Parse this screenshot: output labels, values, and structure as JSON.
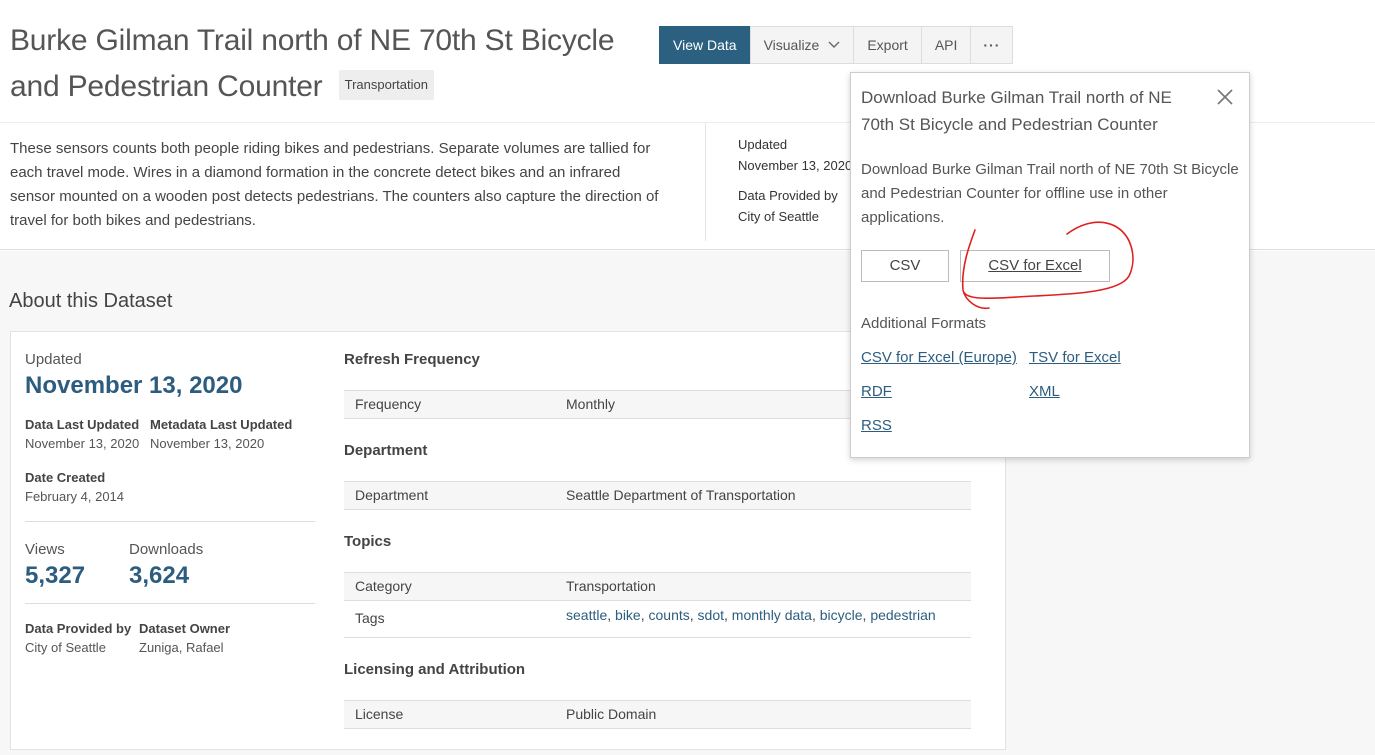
{
  "header": {
    "title": "Burke Gilman Trail north of NE 70th St Bicycle and Pedestrian Counter",
    "category_tag": "Transportation"
  },
  "toolbar": {
    "view_data": "View Data",
    "visualize": "Visualize",
    "export": "Export",
    "api": "API",
    "more": "···"
  },
  "description": "These sensors counts both people riding bikes and pedestrians. Separate volumes are tallied for each travel mode. Wires in a diamond formation in the concrete detect bikes and an infrared sensor mounted on a wooden post detects pedestrians. The counters also capture the direction of travel for both bikes and pedestrians.",
  "side_info": {
    "updated_label": "Updated",
    "updated_value": "November 13, 2020",
    "provided_label": "Data Provided by",
    "provided_value": "City of Seattle"
  },
  "about": {
    "heading": "About this Dataset",
    "updated_label": "Updated",
    "updated_value": "November 13, 2020",
    "data_last_updated_label": "Data Last Updated",
    "data_last_updated_value": "November 13, 2020",
    "metadata_last_updated_label": "Metadata Last Updated",
    "metadata_last_updated_value": "November 13, 2020",
    "date_created_label": "Date Created",
    "date_created_value": "February 4, 2014",
    "views_label": "Views",
    "views_value": "5,327",
    "downloads_label": "Downloads",
    "downloads_value": "3,624",
    "provided_label": "Data Provided by",
    "provided_value": "City of Seattle",
    "owner_label": "Dataset Owner",
    "owner_value": "Zuniga, Rafael"
  },
  "sections": {
    "refresh": {
      "heading": "Refresh Frequency",
      "key": "Frequency",
      "value": "Monthly"
    },
    "department": {
      "heading": "Department",
      "key": "Department",
      "value": "Seattle Department of Transportation"
    },
    "topics": {
      "heading": "Topics",
      "category_key": "Category",
      "category_value": "Transportation",
      "tags_key": "Tags",
      "tags": [
        "seattle",
        "bike",
        "counts",
        "sdot",
        "monthly data",
        "bicycle",
        "pedestrian"
      ]
    },
    "licensing": {
      "heading": "Licensing and Attribution",
      "key": "License",
      "value": "Public Domain"
    }
  },
  "download_popup": {
    "title": "Download Burke Gilman Trail north of NE 70th St Bicycle and Pedestrian Counter",
    "body": "Download Burke Gilman Trail north of NE 70th St Bicycle and Pedestrian Counter for offline use in other applications.",
    "csv": "CSV",
    "csv_excel": "CSV for Excel",
    "additional_formats": "Additional Formats",
    "formats": [
      "CSV for Excel (Europe)",
      "TSV for Excel",
      "RDF",
      "XML",
      "RSS"
    ]
  },
  "colors": {
    "primary": "#2c6080",
    "link": "#2c5d7f",
    "annotation": "#e02020"
  }
}
